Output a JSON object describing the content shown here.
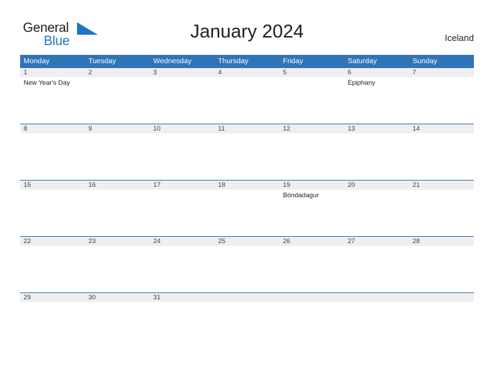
{
  "brand": {
    "name_part1": "General",
    "name_part2": "Blue",
    "color_dark": "#231f20",
    "color_blue": "#1f77c2"
  },
  "header": {
    "title": "January 2024",
    "region": "Iceland"
  },
  "theme": {
    "header_blue": "#2f74b5",
    "band_gray": "#efefef",
    "text_dark": "#231f20"
  },
  "calendar": {
    "weekdays": [
      "Monday",
      "Tuesday",
      "Wednesday",
      "Thursday",
      "Friday",
      "Saturday",
      "Sunday"
    ],
    "weeks": [
      {
        "days": [
          {
            "num": "1",
            "events": [
              "New Year's Day"
            ]
          },
          {
            "num": "2",
            "events": []
          },
          {
            "num": "3",
            "events": []
          },
          {
            "num": "4",
            "events": []
          },
          {
            "num": "5",
            "events": []
          },
          {
            "num": "6",
            "events": [
              "Epiphany"
            ]
          },
          {
            "num": "7",
            "events": []
          }
        ]
      },
      {
        "days": [
          {
            "num": "8",
            "events": []
          },
          {
            "num": "9",
            "events": []
          },
          {
            "num": "10",
            "events": []
          },
          {
            "num": "11",
            "events": []
          },
          {
            "num": "12",
            "events": []
          },
          {
            "num": "13",
            "events": []
          },
          {
            "num": "14",
            "events": []
          }
        ]
      },
      {
        "days": [
          {
            "num": "15",
            "events": []
          },
          {
            "num": "16",
            "events": []
          },
          {
            "num": "17",
            "events": []
          },
          {
            "num": "18",
            "events": []
          },
          {
            "num": "19",
            "events": [
              "Bóndadagur"
            ]
          },
          {
            "num": "20",
            "events": []
          },
          {
            "num": "21",
            "events": []
          }
        ]
      },
      {
        "days": [
          {
            "num": "22",
            "events": []
          },
          {
            "num": "23",
            "events": []
          },
          {
            "num": "24",
            "events": []
          },
          {
            "num": "25",
            "events": []
          },
          {
            "num": "26",
            "events": []
          },
          {
            "num": "27",
            "events": []
          },
          {
            "num": "28",
            "events": []
          }
        ]
      },
      {
        "days": [
          {
            "num": "29",
            "events": []
          },
          {
            "num": "30",
            "events": []
          },
          {
            "num": "31",
            "events": []
          },
          {
            "num": "",
            "events": []
          },
          {
            "num": "",
            "events": []
          },
          {
            "num": "",
            "events": []
          },
          {
            "num": "",
            "events": []
          }
        ]
      }
    ]
  }
}
